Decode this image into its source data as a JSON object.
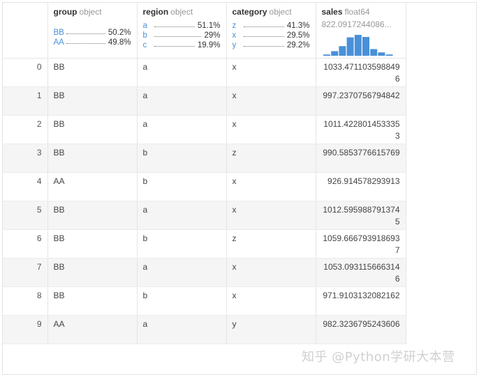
{
  "columns": {
    "group": {
      "name": "group",
      "dtype": "object",
      "freq": [
        {
          "label": "BB",
          "pct": "50.2%"
        },
        {
          "label": "AA",
          "pct": "49.8%"
        }
      ]
    },
    "region": {
      "name": "region",
      "dtype": "object",
      "freq": [
        {
          "label": "a",
          "pct": "51.1%"
        },
        {
          "label": "b",
          "pct": "29%"
        },
        {
          "label": "c",
          "pct": "19.9%"
        }
      ]
    },
    "category": {
      "name": "category",
      "dtype": "object",
      "freq": [
        {
          "label": "z",
          "pct": "41.3%"
        },
        {
          "label": "x",
          "pct": "29.5%"
        },
        {
          "label": "y",
          "pct": "29.2%"
        }
      ]
    },
    "sales": {
      "name": "sales",
      "dtype": "float64",
      "summary_value": "822.0917244086...",
      "histogram": [
        0.06,
        0.22,
        0.46,
        0.88,
        1.0,
        0.9,
        0.32,
        0.16,
        0.06
      ],
      "histogram_color": "#4a90d9"
    }
  },
  "rows": [
    {
      "index": "0",
      "group": "BB",
      "region": "a",
      "category": "x",
      "sales": "1033.4711035988496"
    },
    {
      "index": "1",
      "group": "BB",
      "region": "a",
      "category": "x",
      "sales": "997.2370756794842"
    },
    {
      "index": "2",
      "group": "BB",
      "region": "a",
      "category": "x",
      "sales": "1011.4228014533353"
    },
    {
      "index": "3",
      "group": "BB",
      "region": "b",
      "category": "z",
      "sales": "990.5853776615769"
    },
    {
      "index": "4",
      "group": "AA",
      "region": "b",
      "category": "x",
      "sales": "926.914578293913"
    },
    {
      "index": "5",
      "group": "BB",
      "region": "a",
      "category": "x",
      "sales": "1012.5959887913745"
    },
    {
      "index": "6",
      "group": "BB",
      "region": "b",
      "category": "z",
      "sales": "1059.6667939186937"
    },
    {
      "index": "7",
      "group": "BB",
      "region": "a",
      "category": "x",
      "sales": "1053.0931156663146"
    },
    {
      "index": "8",
      "group": "BB",
      "region": "b",
      "category": "x",
      "sales": "971.9103132082162"
    },
    {
      "index": "9",
      "group": "AA",
      "region": "a",
      "category": "y",
      "sales": "982.3236795243606"
    }
  ],
  "watermark": "知乎 @Python学研大本营",
  "colors": {
    "accent": "#4a90d9",
    "stripe": "#f5f5f5"
  }
}
